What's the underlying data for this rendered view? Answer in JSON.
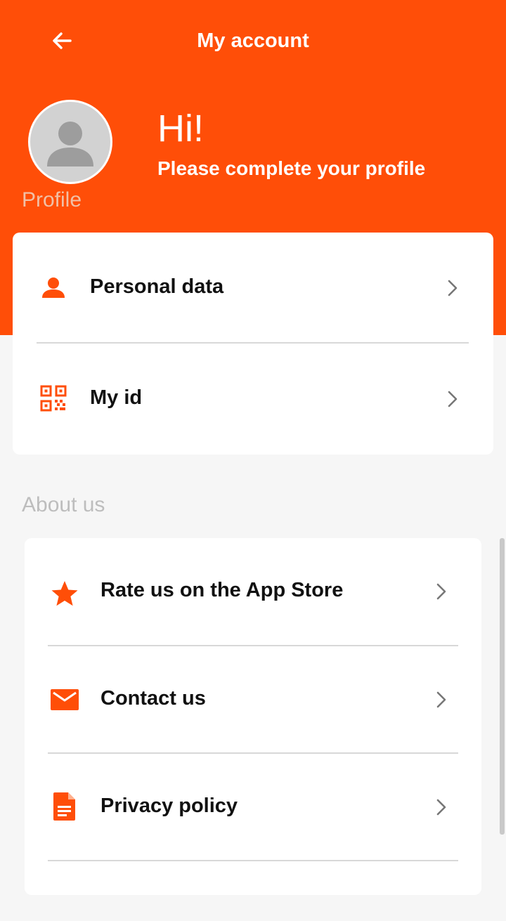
{
  "header": {
    "title": "My account",
    "greeting": "Hi!",
    "subtitle": "Please complete your profile",
    "profile_label": "Profile",
    "back_icon": "arrow-left-icon",
    "brand_color": "#ff4e08"
  },
  "account_menu": {
    "items": [
      {
        "label": "Personal data",
        "icon": "person-icon"
      },
      {
        "label": "My id",
        "icon": "qr-code-icon"
      }
    ]
  },
  "about": {
    "title": "About us",
    "items": [
      {
        "label": "Rate us on the App Store",
        "icon": "star-icon"
      },
      {
        "label": "Contact us",
        "icon": "mail-icon"
      },
      {
        "label": "Privacy policy",
        "icon": "document-icon"
      }
    ]
  }
}
